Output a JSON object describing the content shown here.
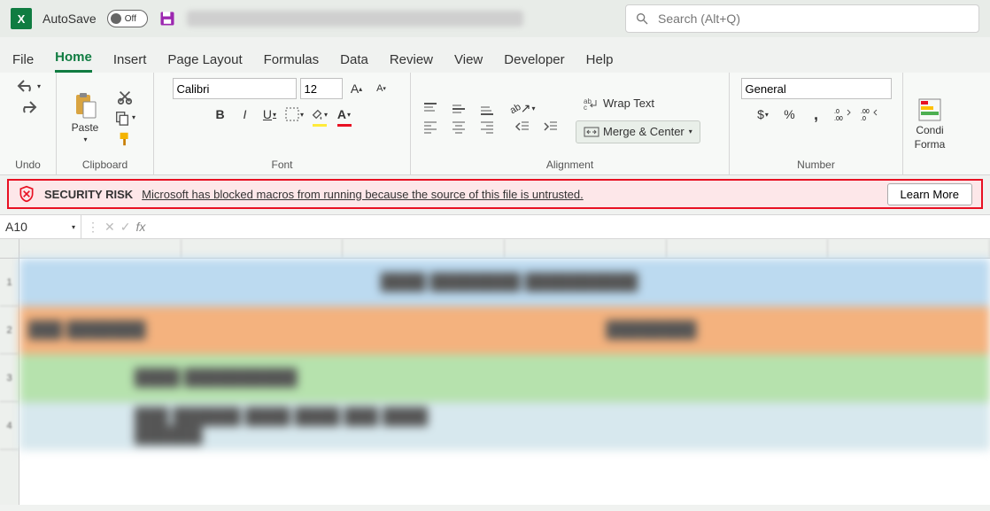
{
  "titlebar": {
    "autosave_label": "AutoSave",
    "autosave_state": "Off",
    "search_placeholder": "Search (Alt+Q)"
  },
  "tabs": {
    "file": "File",
    "home": "Home",
    "insert": "Insert",
    "page_layout": "Page Layout",
    "formulas": "Formulas",
    "data": "Data",
    "review": "Review",
    "view": "View",
    "developer": "Developer",
    "help": "Help"
  },
  "ribbon": {
    "undo_label": "Undo",
    "clipboard": {
      "label": "Clipboard",
      "paste": "Paste"
    },
    "font": {
      "label": "Font",
      "name": "Calibri",
      "size": "12",
      "bold": "B",
      "italic": "I",
      "underline": "U"
    },
    "alignment": {
      "label": "Alignment",
      "wrap": "Wrap Text",
      "merge": "Merge & Center"
    },
    "number": {
      "label": "Number",
      "format": "General",
      "percent": "%",
      "comma": ","
    },
    "styles": {
      "cond": "Conditional Formatting"
    },
    "cond_line1": "Condi",
    "cond_line2": "Forma"
  },
  "security": {
    "title": "SECURITY RISK",
    "message": "Microsoft has blocked macros from running because the source of this file is untrusted.",
    "learn": "Learn More"
  },
  "formula_bar": {
    "cell_ref": "A10",
    "fx": "fx"
  }
}
